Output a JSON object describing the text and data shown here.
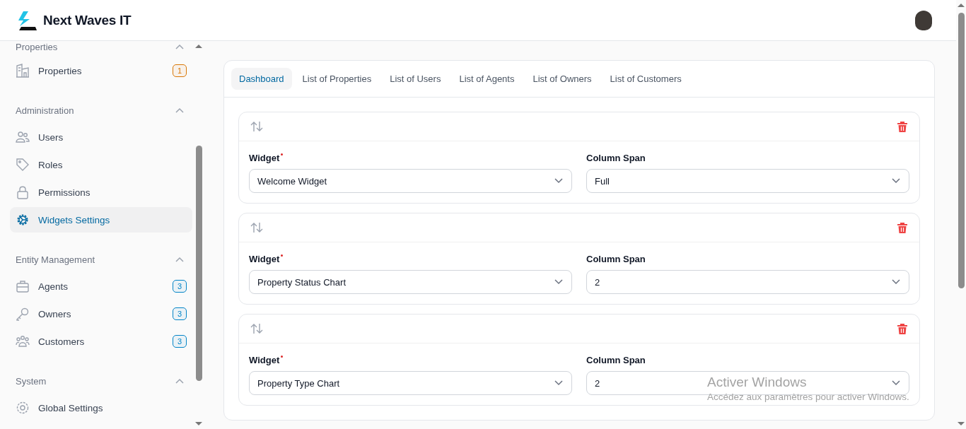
{
  "brand": {
    "name": "Next Waves IT"
  },
  "sidebar": {
    "groups": [
      {
        "label": "Properties",
        "expanded": true,
        "items": [
          {
            "label": "Properties",
            "selected": false,
            "badge": {
              "text": "1",
              "color": "#d97706"
            }
          }
        ]
      },
      {
        "label": "Administration",
        "expanded": true,
        "items": [
          {
            "label": "Users",
            "selected": false
          },
          {
            "label": "Roles",
            "selected": false
          },
          {
            "label": "Permissions",
            "selected": false
          },
          {
            "label": "Widgets Settings",
            "selected": true
          }
        ]
      },
      {
        "label": "Entity Management",
        "expanded": true,
        "items": [
          {
            "label": "Agents",
            "selected": false,
            "badge": {
              "text": "3",
              "color": "#0284c7"
            }
          },
          {
            "label": "Owners",
            "selected": false,
            "badge": {
              "text": "3",
              "color": "#0284c7"
            }
          },
          {
            "label": "Customers",
            "selected": false,
            "badge": {
              "text": "3",
              "color": "#0284c7"
            }
          }
        ]
      },
      {
        "label": "System",
        "expanded": true,
        "items": [
          {
            "label": "Global Settings",
            "selected": false
          }
        ]
      }
    ]
  },
  "tabs": [
    {
      "label": "Dashboard",
      "selected": true
    },
    {
      "label": "List of Properties",
      "selected": false
    },
    {
      "label": "List of Users",
      "selected": false
    },
    {
      "label": "List of Agents",
      "selected": false
    },
    {
      "label": "List of Owners",
      "selected": false
    },
    {
      "label": "List of Customers",
      "selected": false
    }
  ],
  "widgets": [
    {
      "widget_label": "Widget",
      "required": true,
      "widget_value": "Welcome Widget",
      "span_label": "Column Span",
      "span_value": "Full"
    },
    {
      "widget_label": "Widget",
      "required": true,
      "widget_value": "Property Status Chart",
      "span_label": "Column Span",
      "span_value": "2"
    },
    {
      "widget_label": "Widget",
      "required": true,
      "widget_value": "Property Type Chart",
      "span_label": "Column Span",
      "span_value": "2"
    }
  ],
  "windows_notice": {
    "title": "Activer Windows",
    "text": "Accédez aux paramètres pour activer Windows."
  }
}
